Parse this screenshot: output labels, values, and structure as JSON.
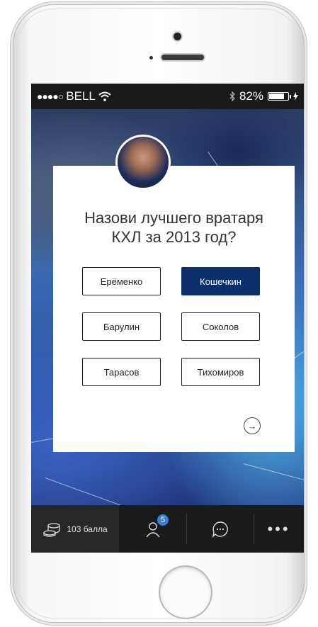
{
  "status_bar": {
    "signal_dots": "●●●●○",
    "carrier": "BELL",
    "battery_percent": "82%",
    "battery_level": 0.82
  },
  "quiz": {
    "question_line1": "Назови лучшего вратаря",
    "question_line2": "КХЛ за 2013 год?",
    "options": [
      "Ерёменко",
      "Кошечкин",
      "Барулин",
      "Соколов",
      "Тарасов",
      "Тихомиров"
    ],
    "selected_option": "Кошечкин",
    "next_symbol": "→"
  },
  "tabbar": {
    "points_label": "103 балла",
    "friends_badge": "5",
    "more_symbol": "•••"
  },
  "colors": {
    "selected": "#0b2f6a",
    "badge": "#3b7fd6",
    "tabbar": "#1b1b1b"
  }
}
